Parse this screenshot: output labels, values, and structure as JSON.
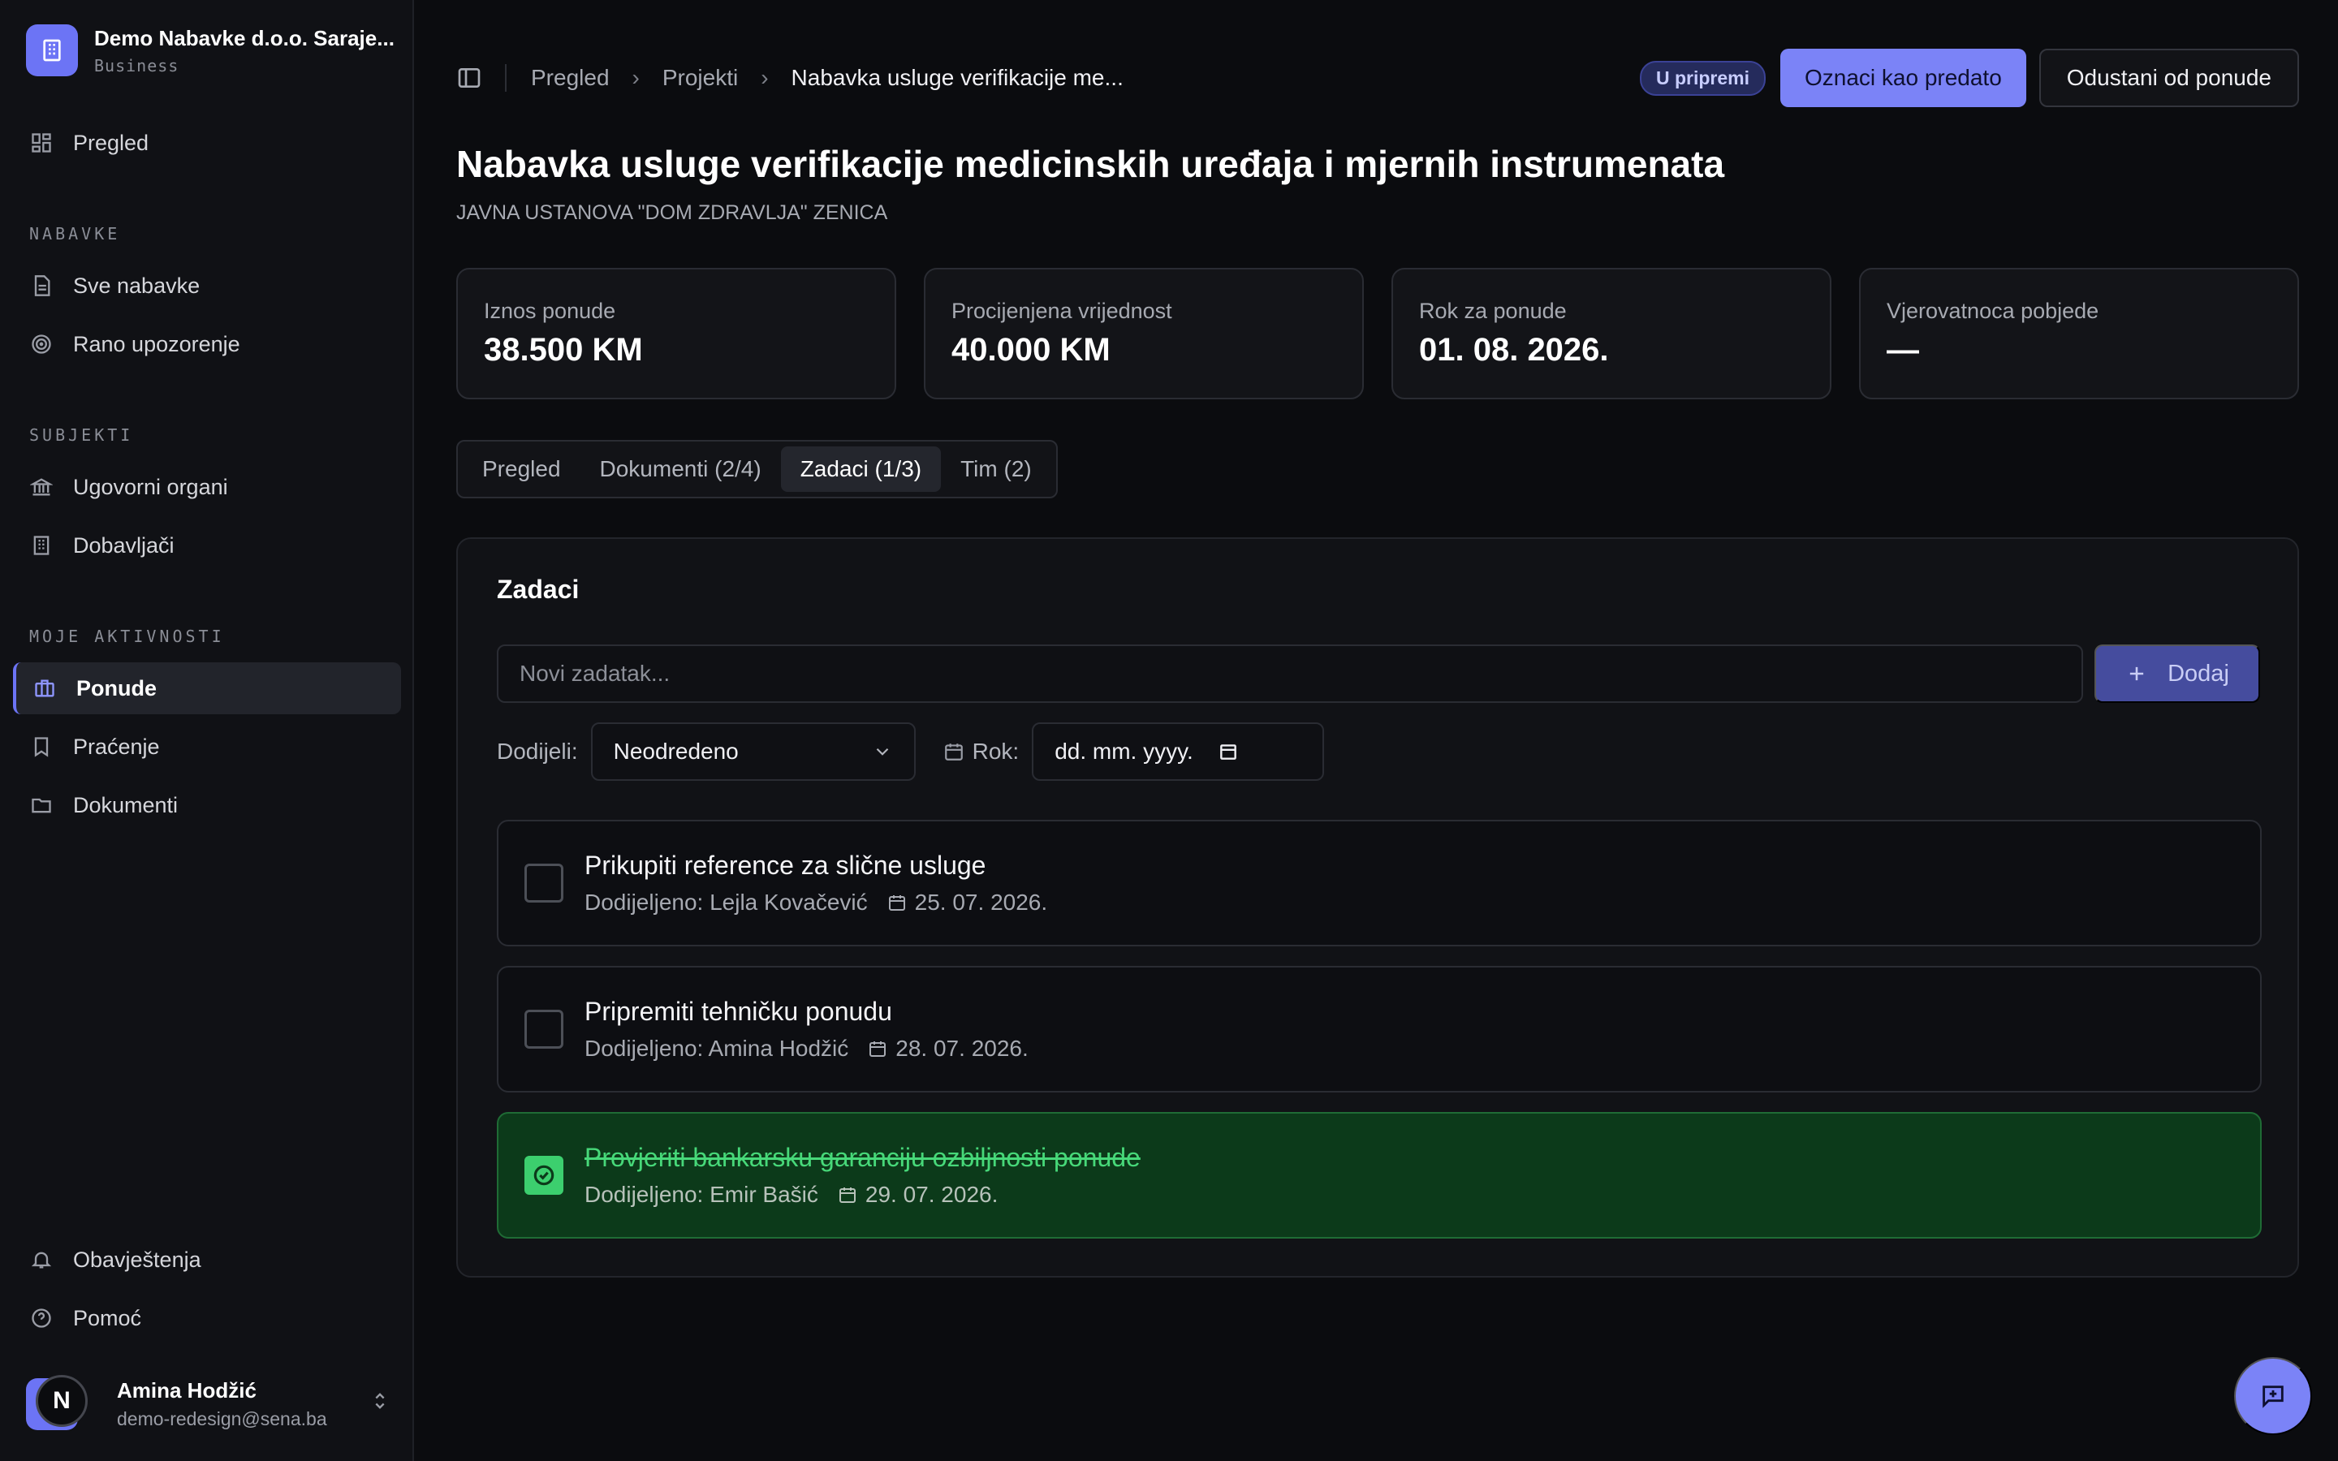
{
  "org": {
    "name": "Demo Nabavke d.o.o. Saraje...",
    "plan": "Business"
  },
  "sidebar": {
    "overview": "Pregled",
    "sections": {
      "nabavke": "NABAVKE",
      "subjekti": "SUBJEKTI",
      "aktivnosti": "MOJE AKTIVNOSTI"
    },
    "items": {
      "sve_nabavke": "Sve nabavke",
      "rano": "Rano upozorenje",
      "ugovorni": "Ugovorni organi",
      "dobavljaci": "Dobavljači",
      "ponude": "Ponude",
      "pracenje": "Praćenje",
      "dokumenti": "Dokumenti",
      "obavjestenja": "Obavještenja",
      "pomoc": "Pomoć"
    },
    "active_item": "ponude"
  },
  "user": {
    "initial": "N",
    "name": "Amina Hodžić",
    "email": "demo-redesign@sena.ba"
  },
  "breadcrumb": {
    "root": "Pregled",
    "section": "Projekti",
    "current": "Nabavka usluge verifikacije me..."
  },
  "header": {
    "status": "U pripremi",
    "primary_action": "Oznaci kao predato",
    "secondary_action": "Odustani od ponude"
  },
  "page": {
    "title": "Nabavka usluge verifikacije medicinskih uređaja i mjernih instrumenata",
    "subtitle": "JAVNA USTANOVA \"DOM ZDRAVLJA\" ZENICA"
  },
  "stats": [
    {
      "label": "Iznos ponude",
      "value": "38.500 KM"
    },
    {
      "label": "Procijenjena vrijednost",
      "value": "40.000 KM"
    },
    {
      "label": "Rok za ponude",
      "value": "01. 08. 2026."
    },
    {
      "label": "Vjerovatnoca pobjede",
      "value": "—"
    }
  ],
  "tabs": [
    {
      "label": "Pregled"
    },
    {
      "label": "Dokumenti (2/4)"
    },
    {
      "label": "Zadaci (1/3)"
    },
    {
      "label": "Tim (2)"
    }
  ],
  "active_tab": 2,
  "tasks_card": {
    "title": "Zadaci",
    "new_placeholder": "Novi zadatak...",
    "add_label": "Dodaj",
    "assign_label": "Dodijeli:",
    "assign_value": "Neodredeno",
    "due_label": "Rok:",
    "due_placeholder": "dd. mm. yyyy."
  },
  "tasks": [
    {
      "title": "Prikupiti reference za slične usluge",
      "assignee": "Dodijeljeno: Lejla Kovačević",
      "due": "25. 07. 2026.",
      "done": false
    },
    {
      "title": "Pripremiti tehničku ponudu",
      "assignee": "Dodijeljeno: Amina Hodžić",
      "due": "28. 07. 2026.",
      "done": false
    },
    {
      "title": "Provjeriti bankarsku garanciju ozbiljnosti ponude",
      "assignee": "Dodijeljeno: Emir Bašić",
      "due": "29. 07. 2026.",
      "done": true
    }
  ],
  "colors": {
    "accent": "#7b83f7",
    "done_bg": "#0c3a1a",
    "done_text": "#47d879",
    "background": "#0b0c0f"
  }
}
